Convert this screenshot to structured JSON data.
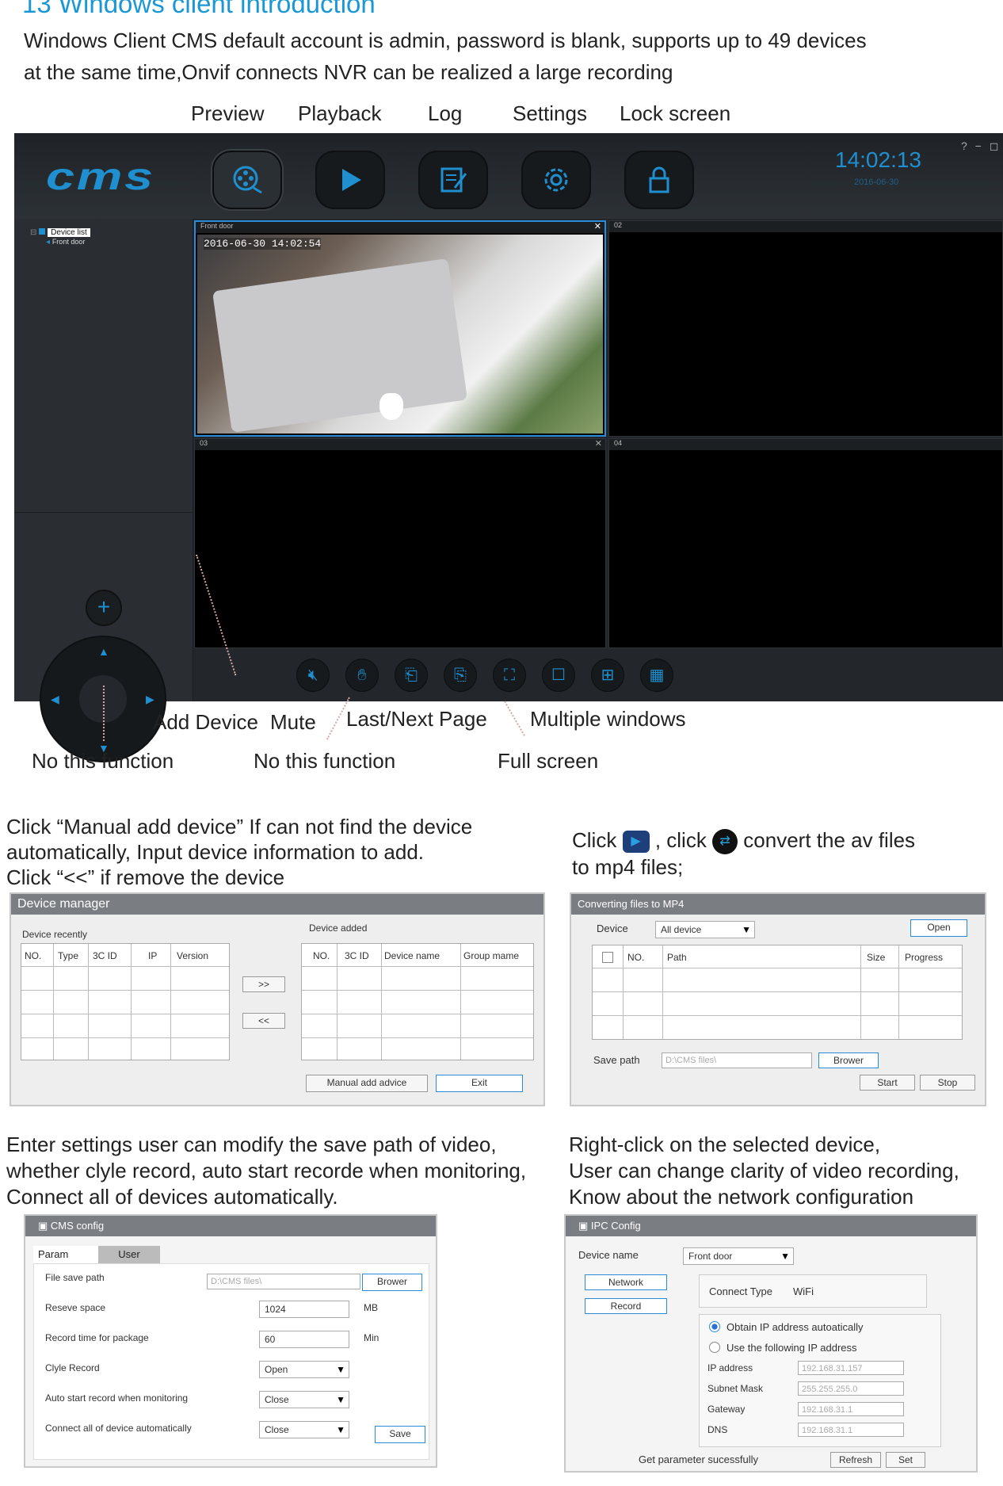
{
  "heading": "13    Windows client introduction",
  "intro": {
    "line1": "Windows Client CMS default account is admin, password is blank, supports up to 49 devices",
    "line2": "at the same time,Onvif connects NVR can be realized a large recording"
  },
  "top_labels": [
    "Preview",
    "Playback",
    "Log",
    "Settings",
    "Lock screen"
  ],
  "app": {
    "logo": "cms",
    "clock": "14:02:13",
    "clock_date": "2016-06-30",
    "window_controls": "? − ◻",
    "nav_icons": [
      "preview-icon",
      "playback-icon",
      "log-icon",
      "settings-icon",
      "lock-icon"
    ],
    "tree": {
      "root": "Device list",
      "child": "Front door"
    },
    "panes": [
      {
        "title": "Front door",
        "timestamp": "2016-06-30  14:02:54"
      },
      {
        "title": "02"
      },
      {
        "title": "03"
      },
      {
        "title": "04"
      }
    ],
    "bottom_icons": [
      "mute-icon",
      "hand-icon",
      "last-page-icon",
      "next-page-icon",
      "fullscreen-icon",
      "single-window-icon",
      "four-window-icon",
      "multi-window-icon"
    ],
    "accent": "#1f8fcf"
  },
  "annotations": {
    "add_device": "Add Device",
    "mute": "Mute",
    "last_next": "Last/Next Page",
    "multiple": "Multiple windows",
    "no_func_1": "No this function",
    "no_func_2": "No this function",
    "full_screen": "Full screen"
  },
  "section1": {
    "line1": "Click  “Manual add device” If can not find the device",
    "line2": "automatically, Input device information to add.",
    "line3": "Click “<<” if remove the device"
  },
  "section2": {
    "click1": "Click",
    "click2": ", click",
    "rest": "convert the av files",
    "line2": "to mp4 files;"
  },
  "section3": {
    "line1": "Enter settings user can modify the save path of video,",
    "line2": "whether clyle record, auto start recorde when monitoring,",
    "line3": "Connect all of devices automatically."
  },
  "section4": {
    "line1": "Right-click on the selected device,",
    "line2": "User can change clarity of video recording,",
    "line3": "Know about the network configuration"
  },
  "device_manager": {
    "title": "Device manager",
    "recent_label": "Device recently",
    "added_label": "Device added",
    "recent_cols": [
      "NO.",
      "Type",
      "3C ID",
      "IP",
      "Version"
    ],
    "added_cols": [
      "NO.",
      "3C ID",
      "Device name",
      "Group mame"
    ],
    "btn_add": ">>",
    "btn_remove": "<<",
    "btn_manual": "Manual add advice",
    "btn_exit": "Exit"
  },
  "converter": {
    "title": "Converting files to MP4",
    "device_label": "Device",
    "device_value": "All device",
    "btn_open": "Open",
    "cols": [
      "NO.",
      "Path",
      "Size",
      "Progress"
    ],
    "save_label": "Save path",
    "save_value": "D:\\CMS files\\",
    "btn_brower": "Brower",
    "btn_start": "Start",
    "btn_stop": "Stop"
  },
  "cms_config": {
    "title": "CMS config",
    "tab_param": "Param",
    "tab_user": "User",
    "rows": [
      {
        "label": "File save path",
        "value": "D:\\CMS files\\"
      },
      {
        "label": "Reseve space",
        "value": "1024",
        "unit": "MB"
      },
      {
        "label": "Record time  for package",
        "value": "60",
        "unit": "Min"
      },
      {
        "label": "Clyle Record",
        "value": "Open"
      },
      {
        "label": "Auto start record when monitoring",
        "value": "Close"
      },
      {
        "label": "Connect all of device automatically",
        "value": "Close"
      }
    ],
    "btn_brower": "Brower",
    "btn_save": "Save"
  },
  "ipc_config": {
    "title": "IPC Config",
    "device_name_label": "Device name",
    "device_name_value": "Front door",
    "btn_network": "Network",
    "btn_record": "Record",
    "connect_type_label": "Connect Type",
    "connect_type_value": "WiFi",
    "radio_auto": "Obtain IP address autoatically",
    "radio_manual": "Use the following IP address",
    "fields": [
      {
        "label": "IP address",
        "value": "192.168.31.157"
      },
      {
        "label": "Subnet Mask",
        "value": "255.255.255.0"
      },
      {
        "label": "Gateway",
        "value": "192.168.31.1"
      },
      {
        "label": "DNS",
        "value": "192.168.31.1"
      }
    ],
    "status": "Get parameter sucessfully",
    "btn_refresh": "Refresh",
    "btn_set": "Set"
  }
}
